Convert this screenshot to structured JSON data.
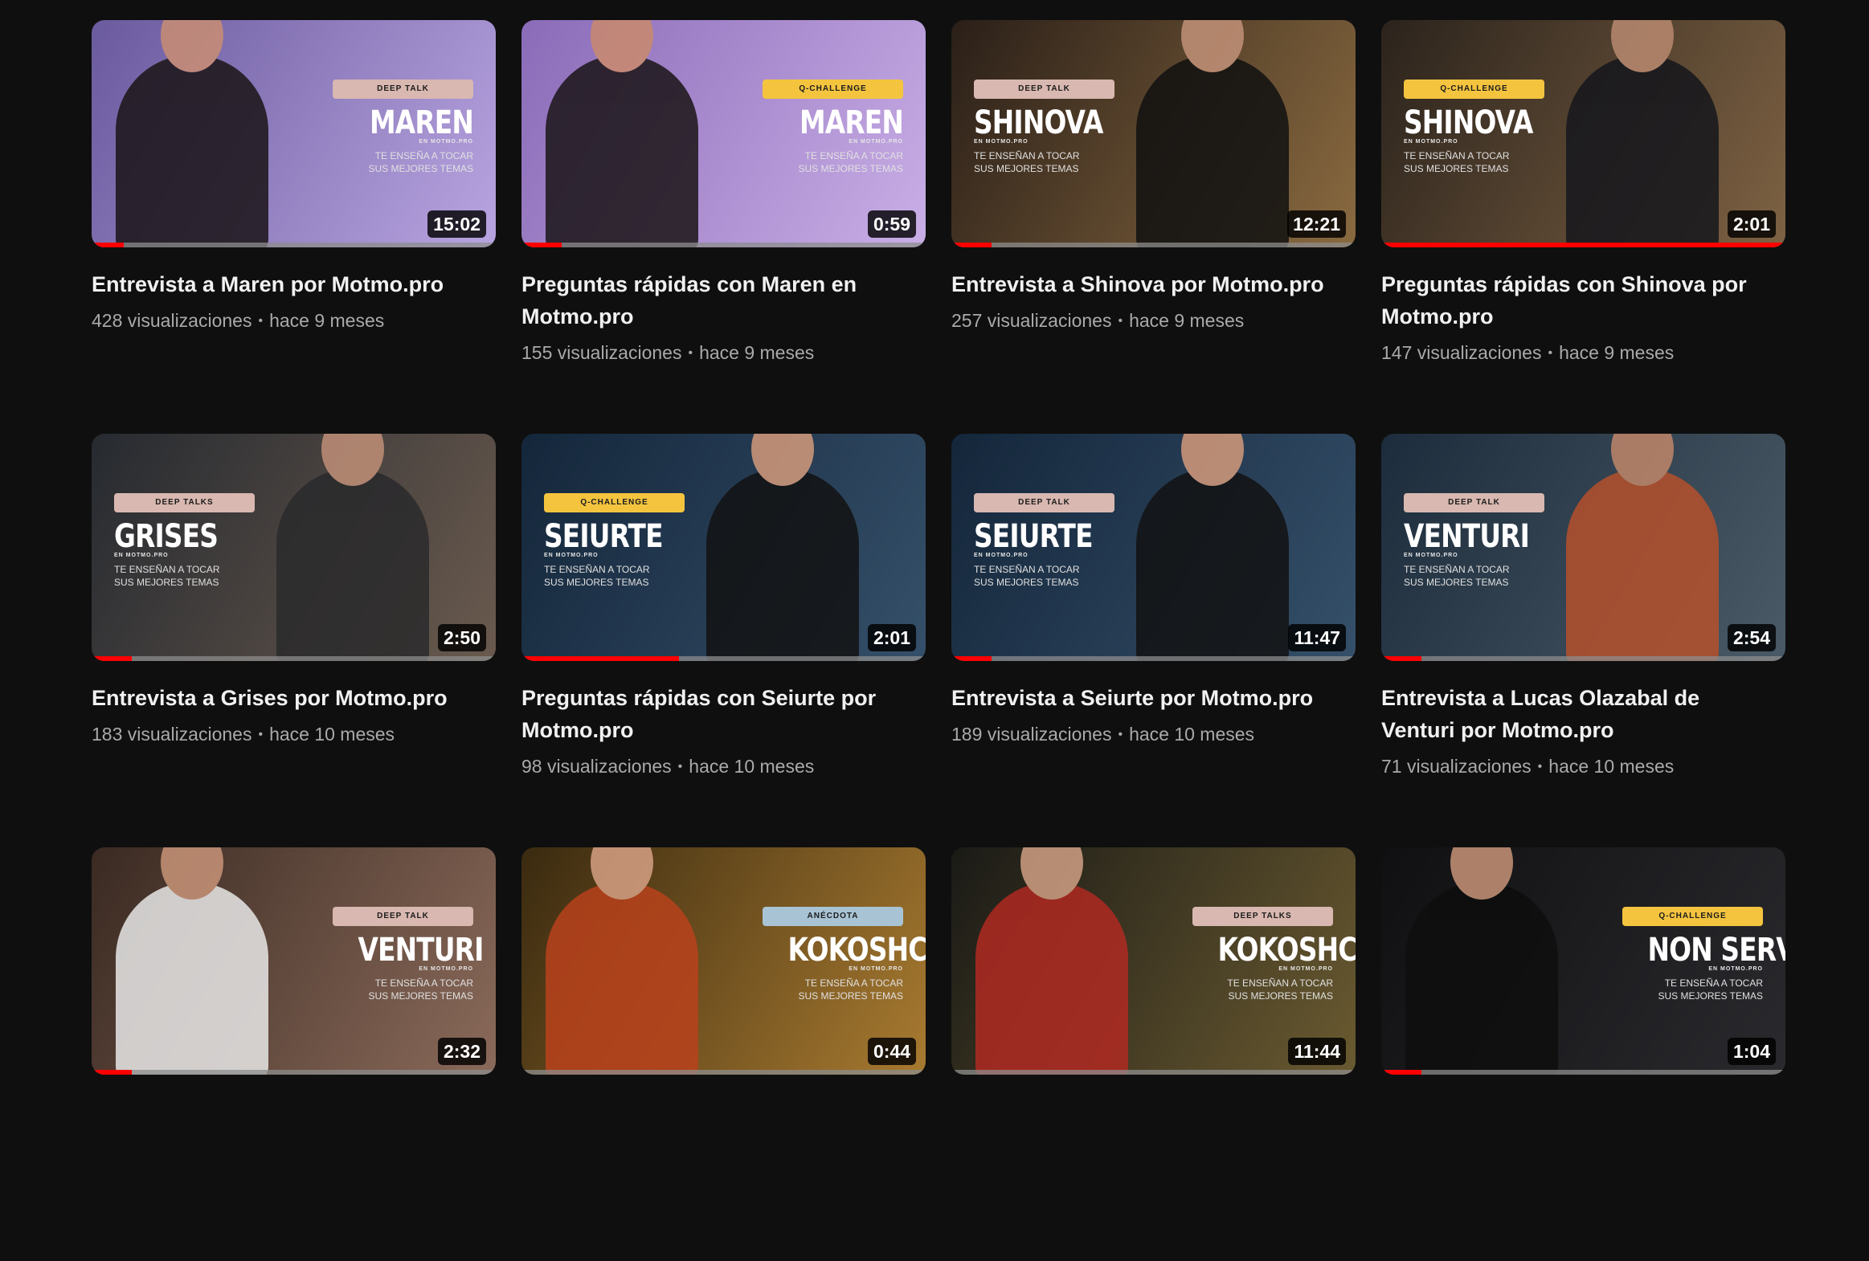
{
  "videos": [
    {
      "badge": "DEEP TALK",
      "name": "MAREN",
      "brand": "EN MOTMO.PRO",
      "tagline": "TE ENSEÑA A TOCAR SUS MEJORES TEMAS",
      "duration": "15:02",
      "progress": 0.08,
      "title": "Entrevista a Maren por Motmo.pro",
      "views": "428 visualizaciones",
      "age": "hace 9 meses",
      "bg1": "#6a5a9e",
      "bg2": "#b8a4e0",
      "figure": "#1a1416",
      "skin": "#c98d74",
      "badge_color": "#d8b8b0",
      "side": "right"
    },
    {
      "badge": "Q-CHALLENGE",
      "name": "MAREN",
      "brand": "EN MOTMO.PRO",
      "tagline": "TE ENSEÑA A TOCAR SUS MEJORES TEMAS",
      "duration": "0:59",
      "progress": 0.1,
      "title": "Preguntas rápidas con Maren en Motmo.pro",
      "views": "155 visualizaciones",
      "age": "hace 9 meses",
      "bg1": "#8a6bb8",
      "bg2": "#c9aee6",
      "figure": "#1b1517",
      "skin": "#c98a6d",
      "badge_color": "#f4c43f",
      "side": "right"
    },
    {
      "badge": "DEEP TALK",
      "name": "SHINOVA",
      "brand": "EN MOTMO.PRO",
      "tagline": "TE ENSEÑAN A TOCAR SUS MEJORES TEMAS",
      "duration": "12:21",
      "progress": 0.1,
      "title": "Entrevista a Shinova por Motmo.pro",
      "views": "257 visualizaciones",
      "age": "hace 9 meses",
      "bg1": "#2a1f18",
      "bg2": "#8a6a40",
      "figure": "#111111",
      "skin": "#c29278",
      "badge_color": "#d8b8b0",
      "side": "left"
    },
    {
      "badge": "Q-CHALLENGE",
      "name": "SHINOVA",
      "brand": "EN MOTMO.PRO",
      "tagline": "TE ENSEÑAN A TOCAR SUS MEJORES TEMAS",
      "duration": "2:01",
      "progress": 1.0,
      "title": "Preguntas rápidas con Shinova por Motmo.pro",
      "views": "147 visualizaciones",
      "age": "hace 9 meses",
      "bg1": "#2b231c",
      "bg2": "#7e6243",
      "figure": "#15161c",
      "skin": "#b98a70",
      "badge_color": "#f4c43f",
      "side": "left"
    },
    {
      "badge": "DEEP TALKS",
      "name": "GRISES",
      "brand": "EN MOTMO.PRO",
      "tagline": "TE ENSEÑAN A TOCAR SUS MEJORES TEMAS",
      "duration": "2:50",
      "progress": 0.1,
      "title": "Entrevista a Grises por Motmo.pro",
      "views": "183 visualizaciones",
      "age": "hace 10 meses",
      "bg1": "#262a30",
      "bg2": "#6a5a4e",
      "figure": "#2a2a2c",
      "skin": "#c09078",
      "badge_color": "#d8b8b0",
      "side": "left"
    },
    {
      "badge": "Q-CHALLENGE",
      "name": "SEIURTE",
      "brand": "EN MOTMO.PRO",
      "tagline": "TE ENSEÑAN A TOCAR SUS MEJORES TEMAS",
      "duration": "2:01",
      "progress": 0.39,
      "title": "Preguntas rápidas con Seiurte por Motmo.pro",
      "views": "98 visualizaciones",
      "age": "hace 10 meses",
      "bg1": "#14263a",
      "bg2": "#35506a",
      "figure": "#121212",
      "skin": "#d49a7c",
      "badge_color": "#f4c43f",
      "side": "left"
    },
    {
      "badge": "DEEP TALK",
      "name": "SEIURTE",
      "brand": "EN MOTMO.PRO",
      "tagline": "TE ENSEÑAN A TOCAR SUS MEJORES TEMAS",
      "duration": "11:47",
      "progress": 0.1,
      "title": "Entrevista a Seiurte por Motmo.pro",
      "views": "189 visualizaciones",
      "age": "hace 10 meses",
      "bg1": "#14263a",
      "bg2": "#35506a",
      "figure": "#121212",
      "skin": "#d49a7c",
      "badge_color": "#d8b8b0",
      "side": "left"
    },
    {
      "badge": "DEEP TALK",
      "name": "VENTURI",
      "brand": "EN MOTMO.PRO",
      "tagline": "TE ENSEÑAN A TOCAR SUS MEJORES TEMAS",
      "duration": "2:54",
      "progress": 0.1,
      "title": "Entrevista a Lucas Olazabal de Venturi por Motmo.pro",
      "views": "71 visualizaciones",
      "age": "hace 10 meses",
      "bg1": "#1c2c3c",
      "bg2": "#4a5a66",
      "figure": "#b5502c",
      "skin": "#c0876a",
      "badge_color": "#d8b8b0",
      "side": "left"
    },
    {
      "badge": "DEEP TALK",
      "name": "VENTURI",
      "brand": "EN MOTMO.PRO",
      "tagline": "TE ENSEÑA A TOCAR SUS MEJORES TEMAS",
      "duration": "2:32",
      "progress": 0.1,
      "title": "",
      "views": "",
      "age": "",
      "bg1": "#3a2a22",
      "bg2": "#8a6a5a",
      "figure": "#e8e8e8",
      "skin": "#c89478",
      "badge_color": "#d8b8b0",
      "side": "right"
    },
    {
      "badge": "ANÉCDOTA",
      "name": "KOKOSHCA",
      "brand": "EN MOTMO.PRO",
      "tagline": "TE ENSEÑA A TOCAR SUS MEJORES TEMAS",
      "duration": "0:44",
      "progress": 0.0,
      "title": "",
      "views": "",
      "age": "",
      "bg1": "#3a2a10",
      "bg2": "#a87a30",
      "figure": "#b8421c",
      "skin": "#d6a084",
      "badge_color": "#a8c4d4",
      "side": "right"
    },
    {
      "badge": "DEEP TALKS",
      "name": "KOKOSHCA",
      "brand": "EN MOTMO.PRO",
      "tagline": "TE ENSEÑAN A TOCAR SUS MEJORES TEMAS",
      "duration": "11:44",
      "progress": 0.0,
      "title": "",
      "views": "",
      "age": "",
      "bg1": "#1a1a16",
      "bg2": "#6a5a30",
      "figure": "#b02a22",
      "skin": "#d0a084",
      "badge_color": "#d8b8b0",
      "side": "right"
    },
    {
      "badge": "Q-CHALLENGE",
      "name": "NON SERVIUM",
      "brand": "EN MOTMO.PRO",
      "tagline": "TE ENSEÑA A TOCAR SUS MEJORES TEMAS",
      "duration": "1:04",
      "progress": 0.1,
      "title": "",
      "views": "",
      "age": "",
      "bg1": "#101012",
      "bg2": "#2a2a2e",
      "figure": "#0e0e0e",
      "skin": "#c89478",
      "badge_color": "#f4c43f",
      "side": "right"
    }
  ]
}
